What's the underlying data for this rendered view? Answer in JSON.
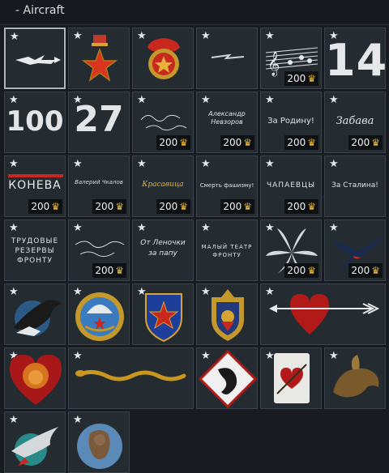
{
  "header": {
    "title": "- Aircraft"
  },
  "currency_icon": "golden-eagle-icon",
  "star_icon": "star-icon",
  "price": "200",
  "decals": {
    "n14": "14",
    "n100": "100",
    "n27": "27",
    "nevzorov": "Александр\nНевзоров",
    "za_rodinu": "За Родину!",
    "zabava": "Забава",
    "koneva": "КОНЕВА",
    "chkalov": "Валерий Чкалов",
    "krasavica": "Красавица",
    "smert": "Смерть фашизму!",
    "chapaevcy": "ЧАПАЕВЦЫ",
    "za_stalina": "За Сталина!",
    "trudovye": "ТРУДОВЫЕ\nРЕЗЕРВЫ\nФРОНТУ",
    "lenochka": "От Леночки\nза папу",
    "malyi_teatr": "МАЛЫЙ ТЕАТР\nФРОНТУ"
  }
}
